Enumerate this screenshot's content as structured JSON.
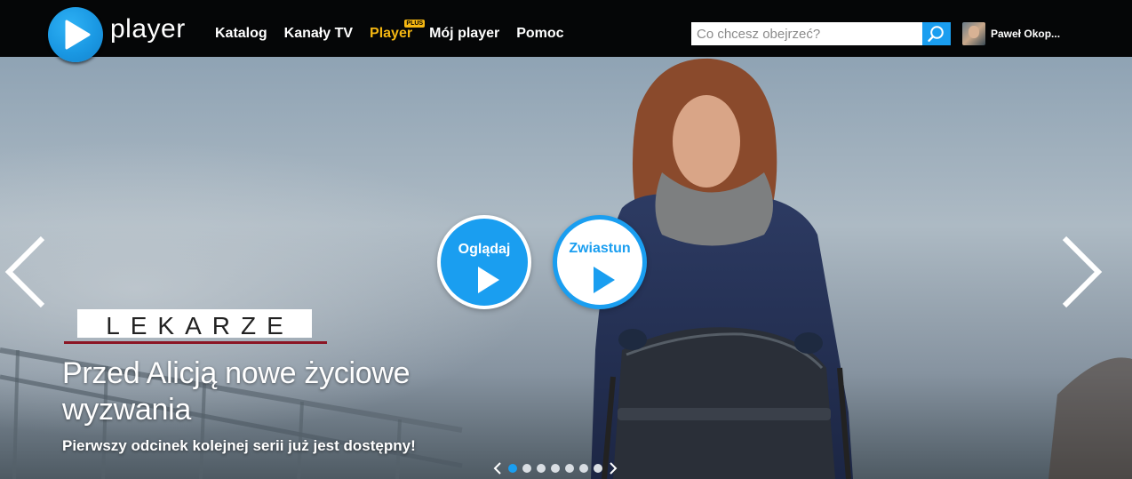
{
  "header": {
    "logo_text": "player",
    "nav": [
      {
        "label": "Katalog"
      },
      {
        "label": "Kanały TV"
      },
      {
        "label": "Player",
        "badge": "PLUS"
      },
      {
        "label": "Mój player"
      },
      {
        "label": "Pomoc"
      }
    ],
    "search": {
      "placeholder": "Co chcesz obejrzeć?"
    },
    "user": {
      "name": "Paweł Okop..."
    }
  },
  "hero": {
    "show_logo": "LEKARZE",
    "title": "Przed Alicją nowe życiowe wyzwania",
    "subtitle": "Pierwszy odcinek kolejnej serii już jest dostępny!",
    "watch_label": "Oglądaj",
    "trailer_label": "Zwiastun",
    "slides_count": 7,
    "active_slide": 1
  },
  "colors": {
    "accent": "#1a9ef0",
    "plus": "#f5b712",
    "topbar": "#050607",
    "logo_underline": "#8b1524"
  },
  "icons": [
    "play-logo-icon",
    "search-icon",
    "chevron-left-icon",
    "chevron-right-icon",
    "play-icon"
  ]
}
